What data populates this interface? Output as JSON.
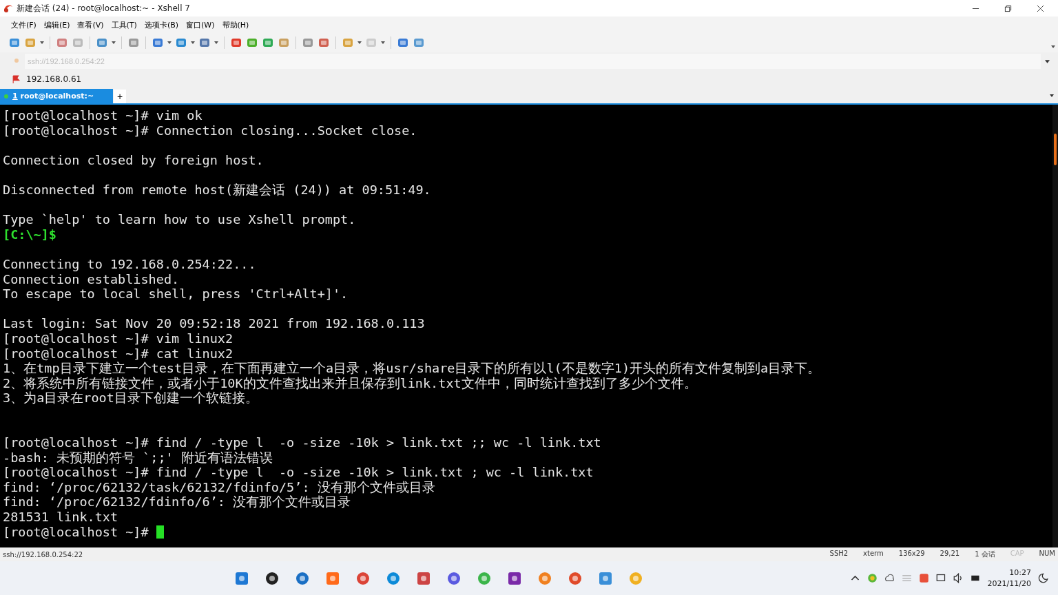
{
  "window": {
    "title": "新建会话 (24) - root@localhost:~ - Xshell 7"
  },
  "menu": [
    "文件(F)",
    "编辑(E)",
    "查看(V)",
    "工具(T)",
    "选项卡(B)",
    "窗口(W)",
    "帮助(H)"
  ],
  "address_bar": {
    "placeholder": "ssh://192.168.0.254:22"
  },
  "session_bar": {
    "label": "192.168.0.61"
  },
  "tabs": [
    {
      "number": "1",
      "label": "root@localhost:~",
      "selected": true
    }
  ],
  "new_tab": "+",
  "terminal": {
    "lines": [
      {
        "kind": "text",
        "text": "[root@localhost ~]# vim ok"
      },
      {
        "kind": "text",
        "text": "[root@localhost ~]# Connection closing...Socket close."
      },
      {
        "kind": "blank"
      },
      {
        "kind": "text",
        "text": "Connection closed by foreign host."
      },
      {
        "kind": "blank"
      },
      {
        "kind": "text",
        "text": "Disconnected from remote host(新建会话 (24)) at 09:51:49."
      },
      {
        "kind": "blank"
      },
      {
        "kind": "text",
        "text": "Type `help' to learn how to use Xshell prompt."
      },
      {
        "kind": "local",
        "text": "[C:\\~]$"
      },
      {
        "kind": "blank"
      },
      {
        "kind": "text",
        "text": "Connecting to 192.168.0.254:22..."
      },
      {
        "kind": "text",
        "text": "Connection established."
      },
      {
        "kind": "text",
        "text": "To escape to local shell, press 'Ctrl+Alt+]'."
      },
      {
        "kind": "blank"
      },
      {
        "kind": "text",
        "text": "Last login: Sat Nov 20 09:52:18 2021 from 192.168.0.113"
      },
      {
        "kind": "text",
        "text": "[root@localhost ~]# vim linux2"
      },
      {
        "kind": "text",
        "text": "[root@localhost ~]# cat linux2"
      },
      {
        "kind": "text",
        "text": "1、在tmp目录下建立一个test目录，在下面再建立一个a目录，将usr/share目录下的所有以l(不是数字1)开头的所有文件复制到a目录下。"
      },
      {
        "kind": "text",
        "text": "2、将系统中所有链接文件，或者小于10K的文件查找出来并且保存到link.txt文件中，同时统计查找到了多少个文件。"
      },
      {
        "kind": "text",
        "text": "3、为a目录在root目录下创建一个软链接。"
      },
      {
        "kind": "blank"
      },
      {
        "kind": "blank"
      },
      {
        "kind": "text",
        "text": "[root@localhost ~]# find / -type l  -o -size -10k > link.txt ;; wc -l link.txt"
      },
      {
        "kind": "text",
        "text": "-bash: 未预期的符号 `;;' 附近有语法错误"
      },
      {
        "kind": "text",
        "text": "[root@localhost ~]# find / -type l  -o -size -10k > link.txt ; wc -l link.txt"
      },
      {
        "kind": "text",
        "text": "find: ‘/proc/62132/task/62132/fdinfo/5’: 没有那个文件或目录"
      },
      {
        "kind": "text",
        "text": "find: ‘/proc/62132/fdinfo/6’: 没有那个文件或目录"
      },
      {
        "kind": "text",
        "text": "281531 link.txt"
      },
      {
        "kind": "cursor",
        "text": "[root@localhost ~]# "
      }
    ]
  },
  "status_bar": {
    "address": "ssh://192.168.0.254:22",
    "items": [
      {
        "label": "SSH2",
        "on": true
      },
      {
        "label": "xterm",
        "on": true
      },
      {
        "label": "136x29",
        "on": true
      },
      {
        "label": "29,21",
        "on": true
      },
      {
        "label": "1 会话",
        "on": true
      },
      {
        "label": "CAP",
        "on": false
      },
      {
        "label": "NUM",
        "on": true
      }
    ]
  },
  "taskbar": {
    "time": "10:27",
    "date": "2021/11/20"
  }
}
